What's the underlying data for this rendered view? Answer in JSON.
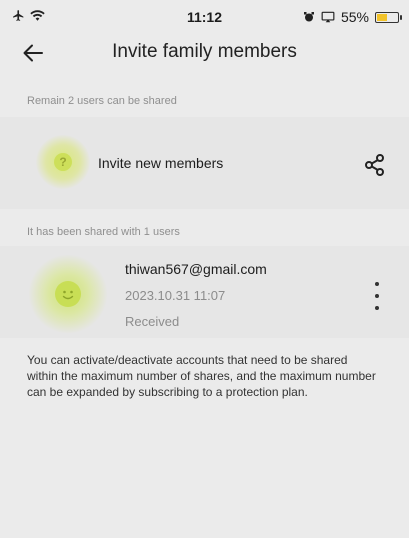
{
  "status_bar": {
    "time": "11:12",
    "battery_percent": "55%",
    "battery_level": 0.55,
    "icons": [
      "airplane-icon",
      "wifi-icon",
      "alarm-icon",
      "screen-mirror-icon",
      "battery-icon"
    ]
  },
  "nav": {
    "title": "Invite family members",
    "back_icon": "arrow-left-icon"
  },
  "invite_section": {
    "label": "Remain 2 users can be shared",
    "invite_label": "Invite new members",
    "avatar_glyph": "?",
    "share_icon": "share-icon"
  },
  "shared_section": {
    "label": "It has been shared with 1 users",
    "users": [
      {
        "email": "thiwan567@gmail.com",
        "timestamp": "2023.10.31 11:07",
        "status": "Received",
        "more_icon": "more-vertical-icon"
      }
    ]
  },
  "note": "You can activate/deactivate accounts that need to be shared within the maximum number of shares, and the maximum number can be expanded by subscribing to a protection plan.",
  "colors": {
    "background": "#ebebeb",
    "card": "#e6e6e6",
    "avatar_accent": "#cddf5a",
    "battery": "#f2c32a"
  }
}
